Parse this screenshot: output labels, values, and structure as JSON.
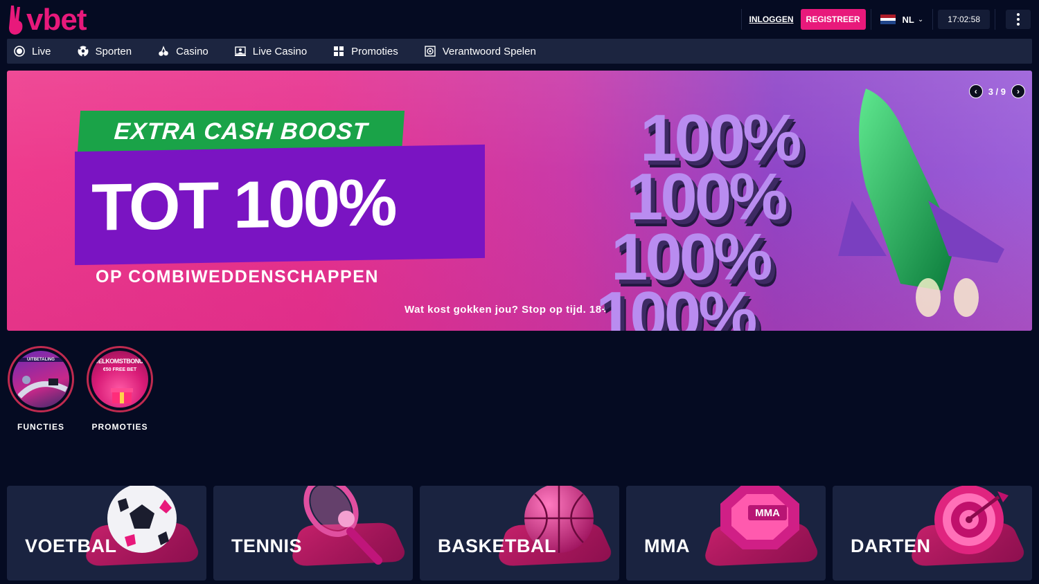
{
  "header": {
    "logo_text": "vbet",
    "login_label": "INLOGGEN",
    "register_label": "REGISTREER",
    "language": "NL",
    "clock": "17:02:58"
  },
  "nav": {
    "items": [
      {
        "label": "Live",
        "icon": "live-icon"
      },
      {
        "label": "Sporten",
        "icon": "soccer-ball-icon"
      },
      {
        "label": "Casino",
        "icon": "cherries-icon"
      },
      {
        "label": "Live Casino",
        "icon": "live-dealer-icon"
      },
      {
        "label": "Promoties",
        "icon": "gift-icon"
      },
      {
        "label": "Verantwoord Spelen",
        "icon": "responsible-gaming-icon"
      }
    ]
  },
  "banner": {
    "tag": "EXTRA CASH BOOST",
    "headline": "TOT 100%",
    "subtitle": "OP COMBIWEDDENSCHAPPEN",
    "disclaimer": "Wat kost gokken jou? Stop op tijd. 18+",
    "big_text": "100%",
    "pager": "3 / 9"
  },
  "stories": [
    {
      "label": "FUNCTIES",
      "thumb_text": "UITBETALING"
    },
    {
      "label": "PROMOTIES",
      "thumb_text": "WELKOMSTBONUS",
      "thumb_sub": "€50 FREE BET"
    }
  ],
  "sports": [
    {
      "label": "VOETBAL",
      "icon": "soccer-ball-icon"
    },
    {
      "label": "TENNIS",
      "icon": "tennis-racket-icon"
    },
    {
      "label": "BASKETBAL",
      "icon": "basketball-icon"
    },
    {
      "label": "MMA",
      "icon": "mma-octagon-icon",
      "badge": "MMA"
    },
    {
      "label": "DARTEN",
      "icon": "dartboard-icon"
    }
  ],
  "colors": {
    "brand": "#e8197b",
    "background": "#050b22",
    "nav_bg": "#1c2540",
    "card_bg": "#1a2340",
    "green_tag": "#1aa348",
    "purple_box": "#7a14c2"
  }
}
